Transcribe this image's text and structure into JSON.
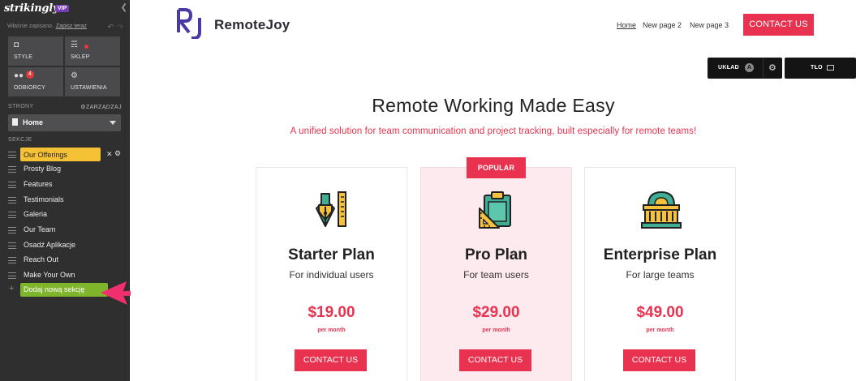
{
  "sidebar": {
    "brand": "strikingly",
    "vip": "VIP",
    "save_status": "Właśnie zapisano.",
    "save_link": "Zapisz teraz",
    "tiles": [
      {
        "label": "STYLE",
        "icon": "palette-icon"
      },
      {
        "label": "SKLEP",
        "icon": "basket-icon"
      },
      {
        "label": "ODBIORCY",
        "icon": "people-icon",
        "badge": "4"
      },
      {
        "label": "USTAWIENIA",
        "icon": "gear-icon"
      }
    ],
    "pages_header": "STRONY",
    "manage_label": "ZARZĄDZAJ",
    "current_page": "Home",
    "sections_header": "SEKCJE",
    "sections": [
      {
        "label": "Our Offerings"
      },
      {
        "label": "Prosty Blog"
      },
      {
        "label": "Features"
      },
      {
        "label": "Testimonials"
      },
      {
        "label": "Galeria"
      },
      {
        "label": "Our Team"
      },
      {
        "label": "Osadź Aplikacje"
      },
      {
        "label": "Reach Out"
      },
      {
        "label": "Make Your Own"
      }
    ],
    "add_section": "Dodaj nową sekcję"
  },
  "site": {
    "logo_mark": "RJ",
    "logo_text": "RemoteJoy",
    "nav": [
      "Home",
      "New page 2",
      "New page 3"
    ],
    "contact": "CONTACT US",
    "editor": {
      "layout_label": "UKŁAD",
      "layout_badge": "A",
      "background_label": "TŁO"
    },
    "headline": "Remote Working Made Easy",
    "subline": "A unified solution for team communication and project tracking, built especially for remote teams!",
    "popular": "POPULAR",
    "plans": [
      {
        "title": "Starter Plan",
        "sub": "For individual users",
        "price": "$19.00",
        "per": "per month",
        "button": "CONTACT US",
        "icon": "drafting-tools-icon"
      },
      {
        "title": "Pro Plan",
        "sub": "For team users",
        "price": "$29.00",
        "per": "per month",
        "button": "CONTACT US",
        "icon": "clipboard-ruler-icon"
      },
      {
        "title": "Enterprise Plan",
        "sub": "For large teams",
        "price": "$49.00",
        "per": "per month",
        "button": "CONTACT US",
        "icon": "building-icon"
      }
    ]
  },
  "colors": {
    "accent": "#e8324f",
    "sidebar": "#2f2f30",
    "active_section": "#f4c234",
    "add_button": "#7fb52a",
    "arrow": "#f0306e"
  }
}
